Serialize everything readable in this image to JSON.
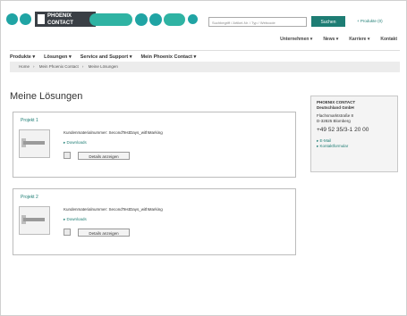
{
  "brand": {
    "logo_line1": "PHOENIX",
    "logo_line2": "CONTACT",
    "accent": "#20a4a4",
    "button_color": "#1e7d74"
  },
  "search": {
    "placeholder": "Suchbegriff / Artikel-Nr. / Typ / Webcode",
    "button_label": "Suchen"
  },
  "compare_label": "+ Produkte (0)",
  "top_nav": [
    "Unternehmen",
    "News",
    "Karriere",
    "Kontakt"
  ],
  "main_nav": [
    "Produkte",
    "Lösungen",
    "Service and Support",
    "Mein Phoenix Contact"
  ],
  "breadcrumb": [
    "Home",
    "Mein Phoenix Contact",
    "Meine Lösungen"
  ],
  "page_title": "Meine Lösungen",
  "projects": [
    {
      "name": "Projekt 1",
      "meta": "Kundenmaterialnummer: SecondTestDays_withMarking",
      "download": "Downloads",
      "details": "Details anzeigen"
    },
    {
      "name": "Projekt 2",
      "meta": "Kundenmaterialnummer: SecondTestDays_withMarking",
      "download": "Downloads",
      "details": "Details anzeigen"
    }
  ],
  "contact": {
    "company_line1": "PHOENIX CONTACT",
    "company_line2": "Deutschland GmbH",
    "street": "Flachsmarktstraße 8",
    "city": "D-32825 Blomberg",
    "phone": "+49 52 35/3-1 20 00",
    "email_link": "E-Mail",
    "form_link": "Kontaktformular"
  }
}
